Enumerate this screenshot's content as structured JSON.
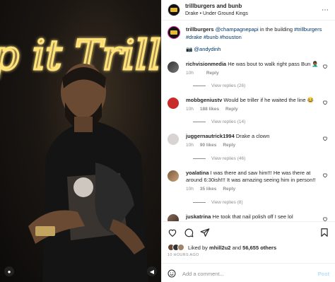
{
  "post": {
    "username": "trillburgers",
    "collab": "and bunb",
    "location": "Drake • Under Ground Kings"
  },
  "caption": {
    "username": "trillburgers",
    "mention": "@champagnepapi",
    "text": "in the building",
    "hashtags": "#trillburgers #drake #bunb #houston",
    "credit": "📷 @andydinh"
  },
  "comments": [
    {
      "username": "richvisionmedia",
      "text": "He was bout to walk right pass Bun 🤦🏾‍♂️",
      "time": "10h",
      "likes": "",
      "reply": "Reply",
      "views": "View replies (26)"
    },
    {
      "username": "mobbgeniustv",
      "text": "Would be triller if he waited the line 😂",
      "time": "10h",
      "likes": "188 likes",
      "reply": "Reply",
      "views": "View replies (14)"
    },
    {
      "username": "juggernautrick1994",
      "text": "Drake a clown",
      "time": "10h",
      "likes": "90 likes",
      "reply": "Reply",
      "views": "View replies (46)"
    },
    {
      "username": "yoalatina",
      "text": "I was there and saw him!!! He was there at around 6:30ish!!! It was amazing seeing him in person!!",
      "time": "10h",
      "likes": "35 likes",
      "reply": "Reply",
      "views": "View replies (8)"
    },
    {
      "username": "juskatrina",
      "text": "He took that nail polish off I see lol",
      "time": "",
      "likes": "",
      "reply": "",
      "views": ""
    }
  ],
  "likes": {
    "prefix": "Liked by",
    "user": "mhill2u2",
    "and": "and",
    "count": "56,655 others",
    "ago": "10 HOURS AGO"
  },
  "add_comment": {
    "placeholder": "Add a comment...",
    "post": "Post"
  },
  "neon_text": "p it Trill",
  "colors": {
    "link": "#00376b",
    "secondary": "#8e8e8e",
    "neon": "#ffe27a",
    "like_heart": "#ed4956"
  }
}
